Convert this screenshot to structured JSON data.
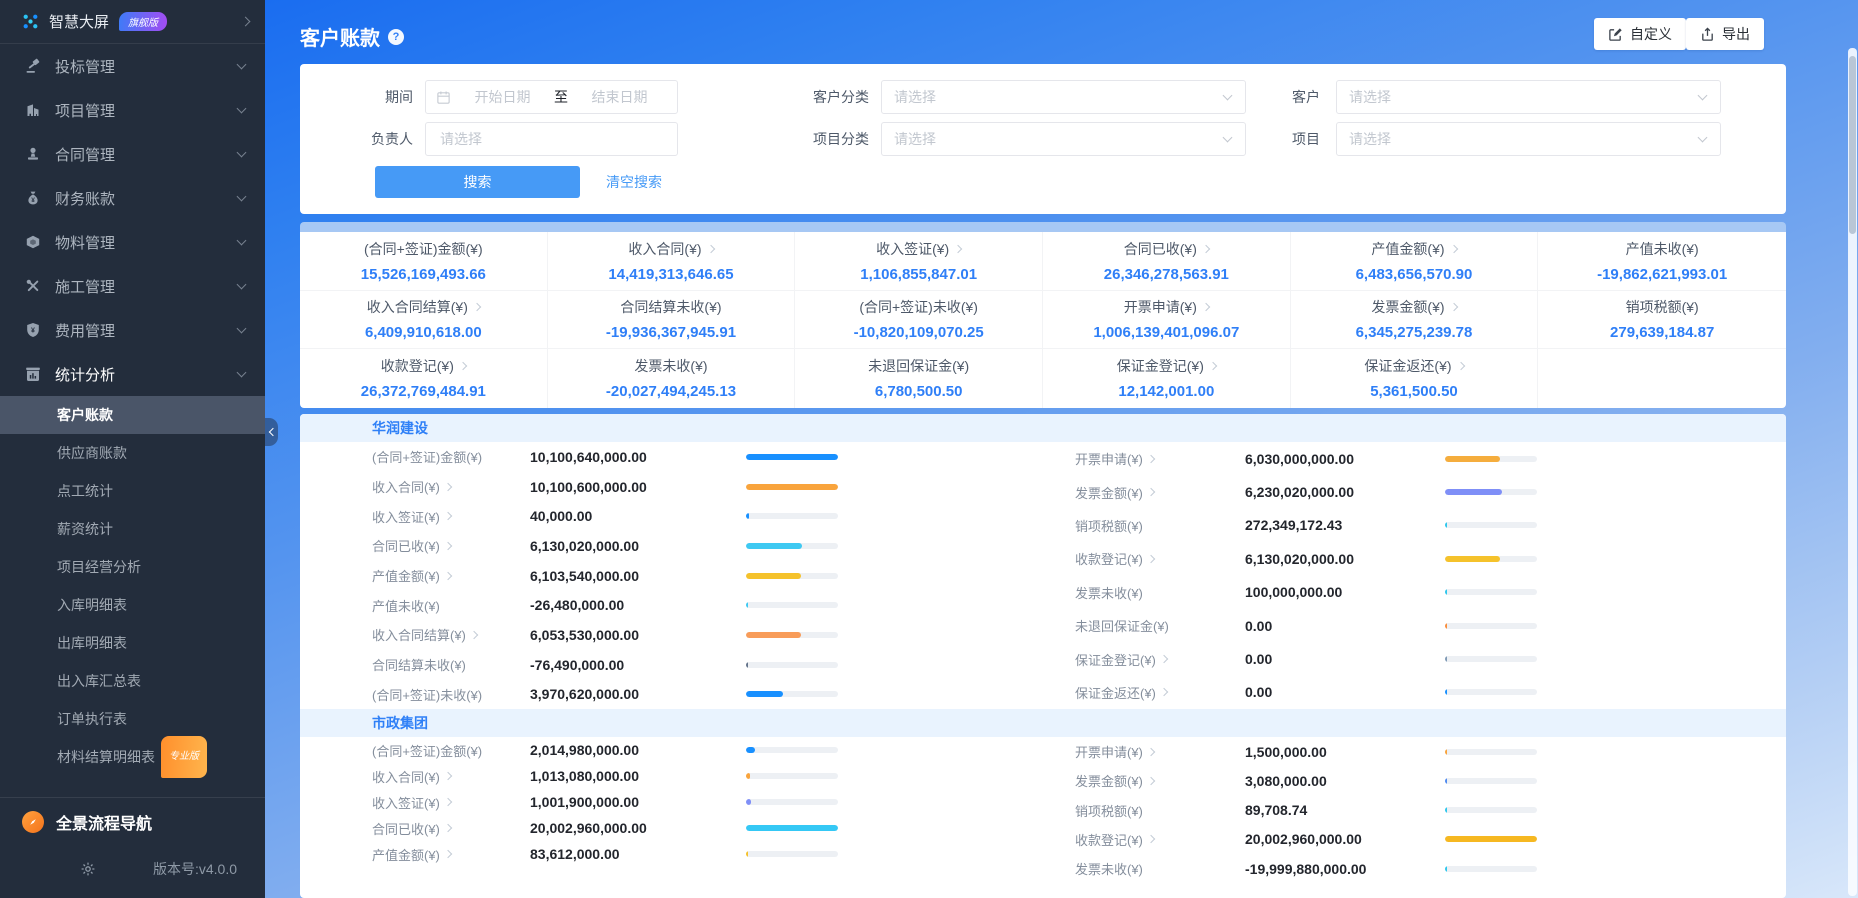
{
  "palette": {
    "accent": "#2f7ff7",
    "sidebar_bg": "#232d3c",
    "header_blue": "#1a6df0",
    "group_header_bg": "#e9f3fe"
  },
  "sidebar": {
    "brand": {
      "label": "智慧大屏",
      "badge": "旗舰版",
      "icon": "logo-icon"
    },
    "menu": [
      {
        "label": "投标管理",
        "icon": "gavel-icon"
      },
      {
        "label": "项目管理",
        "icon": "building-icon"
      },
      {
        "label": "合同管理",
        "icon": "stamp-icon"
      },
      {
        "label": "财务账款",
        "icon": "moneybag-icon"
      },
      {
        "label": "物料管理",
        "icon": "materials-icon"
      },
      {
        "label": "施工管理",
        "icon": "tools-icon"
      },
      {
        "label": "费用管理",
        "icon": "shield-icon"
      },
      {
        "label": "统计分析",
        "icon": "chart-icon",
        "active": true
      }
    ],
    "submenu": [
      {
        "label": "客户账款",
        "active": true
      },
      {
        "label": "供应商账款"
      },
      {
        "label": "点工统计"
      },
      {
        "label": "薪资统计"
      },
      {
        "label": "项目经营分析"
      },
      {
        "label": "入库明细表"
      },
      {
        "label": "出库明细表"
      },
      {
        "label": "出入库汇总表"
      },
      {
        "label": "订单执行表"
      },
      {
        "label": "材料结算明细表",
        "badge": "专业版"
      }
    ],
    "footer_nav": "全景流程导航",
    "version": "版本号:v4.0.0"
  },
  "header": {
    "title": "客户账款",
    "customize_label": "自定义",
    "export_label": "导出"
  },
  "filters": {
    "period_label": "期间",
    "start_placeholder": "开始日期",
    "to_label": "至",
    "end_placeholder": "结束日期",
    "customer_type_label": "客户分类",
    "customer_label": "客户",
    "owner_label": "负责人",
    "project_type_label": "项目分类",
    "project_label": "项目",
    "select_placeholder": "请选择",
    "search_label": "搜索",
    "clear_label": "清空搜索"
  },
  "summary": {
    "cells": [
      {
        "label": "(合同+签证)金额(¥)",
        "arrow": false,
        "value": "15,526,169,493.66"
      },
      {
        "label": "收入合同(¥)",
        "arrow": true,
        "value": "14,419,313,646.65"
      },
      {
        "label": "收入签证(¥)",
        "arrow": true,
        "value": "1,106,855,847.01"
      },
      {
        "label": "合同已收(¥)",
        "arrow": true,
        "value": "26,346,278,563.91"
      },
      {
        "label": "产值金额(¥)",
        "arrow": true,
        "value": "6,483,656,570.90"
      },
      {
        "label": "产值未收(¥)",
        "arrow": false,
        "value": "-19,862,621,993.01"
      },
      {
        "label": "收入合同结算(¥)",
        "arrow": true,
        "value": "6,409,910,618.00"
      },
      {
        "label": "合同结算未收(¥)",
        "arrow": false,
        "value": "-19,936,367,945.91"
      },
      {
        "label": "(合同+签证)未收(¥)",
        "arrow": false,
        "value": "-10,820,109,070.25"
      },
      {
        "label": "开票申请(¥)",
        "arrow": true,
        "value": "1,006,139,401,096.07"
      },
      {
        "label": "发票金额(¥)",
        "arrow": true,
        "value": "6,345,275,239.78"
      },
      {
        "label": "销项税额(¥)",
        "arrow": false,
        "value": "279,639,184.87"
      },
      {
        "label": "收款登记(¥)",
        "arrow": true,
        "value": "26,372,769,484.91"
      },
      {
        "label": "发票未收(¥)",
        "arrow": false,
        "value": "-20,027,494,245.13"
      },
      {
        "label": "未退回保证金(¥)",
        "arrow": false,
        "value": "6,780,500.50"
      },
      {
        "label": "保证金登记(¥)",
        "arrow": true,
        "value": "12,142,001.00"
      },
      {
        "label": "保证金返还(¥)",
        "arrow": true,
        "value": "5,361,500.50"
      },
      {
        "label": "",
        "arrow": false,
        "value": ""
      }
    ]
  },
  "groups": [
    {
      "name": "华润建设",
      "left": [
        {
          "label": "(合同+签证)金额(¥)",
          "arrow": false,
          "value": "10,100,640,000.00",
          "color": "#1890ff",
          "pct": 100
        },
        {
          "label": "收入合同(¥)",
          "arrow": true,
          "value": "10,100,600,000.00",
          "color": "#f9a43c",
          "pct": 100
        },
        {
          "label": "收入签证(¥)",
          "arrow": true,
          "value": "40,000.00",
          "color": "#1890ff",
          "pct": 3
        },
        {
          "label": "合同已收(¥)",
          "arrow": true,
          "value": "6,130,020,000.00",
          "color": "#3ec9f2",
          "pct": 61
        },
        {
          "label": "产值金额(¥)",
          "arrow": true,
          "value": "6,103,540,000.00",
          "color": "#f5c22b",
          "pct": 60
        },
        {
          "label": "产值未收(¥)",
          "arrow": false,
          "value": "-26,480,000.00",
          "color": "#3ec9f2",
          "pct": 2
        },
        {
          "label": "收入合同结算(¥)",
          "arrow": true,
          "value": "6,053,530,000.00",
          "color": "#f89c59",
          "pct": 60
        },
        {
          "label": "合同结算未收(¥)",
          "arrow": false,
          "value": "-76,490,000.00",
          "color": "#64748b",
          "pct": 2
        },
        {
          "label": "(合同+签证)未收(¥)",
          "arrow": false,
          "value": "3,970,620,000.00",
          "color": "#1890ff",
          "pct": 40
        }
      ],
      "right": [
        {
          "label": "开票申请(¥)",
          "arrow": true,
          "value": "6,030,000,000.00",
          "color": "#f5ad3d",
          "pct": 60
        },
        {
          "label": "发票金额(¥)",
          "arrow": true,
          "value": "6,230,020,000.00",
          "color": "#7f8ff7",
          "pct": 62
        },
        {
          "label": "销项税额(¥)",
          "arrow": false,
          "value": "272,349,172.43",
          "color": "#2fc7ec",
          "pct": 2
        },
        {
          "label": "收款登记(¥)",
          "arrow": true,
          "value": "6,130,020,000.00",
          "color": "#f5c22b",
          "pct": 60
        },
        {
          "label": "发票未收(¥)",
          "arrow": false,
          "value": "100,000,000.00",
          "color": "#2fc7ec",
          "pct": 2
        },
        {
          "label": "未退回保证金(¥)",
          "arrow": false,
          "value": "0.00",
          "color": "#f98e3d",
          "pct": 2
        },
        {
          "label": "保证金登记(¥)",
          "arrow": true,
          "value": "0.00",
          "color": "#7f9ab5",
          "pct": 2
        },
        {
          "label": "保证金返还(¥)",
          "arrow": true,
          "value": "0.00",
          "color": "#1890ff",
          "pct": 2
        }
      ]
    },
    {
      "name": "市政集团",
      "left": [
        {
          "label": "(合同+签证)金额(¥)",
          "arrow": false,
          "value": "2,014,980,000.00",
          "color": "#1890ff",
          "pct": 10
        },
        {
          "label": "收入合同(¥)",
          "arrow": true,
          "value": "1,013,080,000.00",
          "color": "#f9a43c",
          "pct": 4
        },
        {
          "label": "收入签证(¥)",
          "arrow": true,
          "value": "1,001,900,000.00",
          "color": "#7f8ff7",
          "pct": 5
        },
        {
          "label": "合同已收(¥)",
          "arrow": true,
          "value": "20,002,960,000.00",
          "color": "#35c8f5",
          "pct": 100
        },
        {
          "label": "产值金额(¥)",
          "arrow": true,
          "value": "83,612,000.00",
          "color": "#f5c22b",
          "pct": 2
        }
      ],
      "right": [
        {
          "label": "开票申请(¥)",
          "arrow": true,
          "value": "1,500,000.00",
          "color": "#f9a43c",
          "pct": 2
        },
        {
          "label": "发票金额(¥)",
          "arrow": true,
          "value": "3,080,000.00",
          "color": "#4f8af0",
          "pct": 2
        },
        {
          "label": "销项税额(¥)",
          "arrow": false,
          "value": "89,708.74",
          "color": "#2fc7ec",
          "pct": 2
        },
        {
          "label": "收款登记(¥)",
          "arrow": true,
          "value": "20,002,960,000.00",
          "color": "#f6b821",
          "pct": 100
        },
        {
          "label": "发票未收(¥)",
          "arrow": false,
          "value": "-19,999,880,000.00",
          "color": "#2fc7ec",
          "pct": 2
        }
      ]
    }
  ]
}
